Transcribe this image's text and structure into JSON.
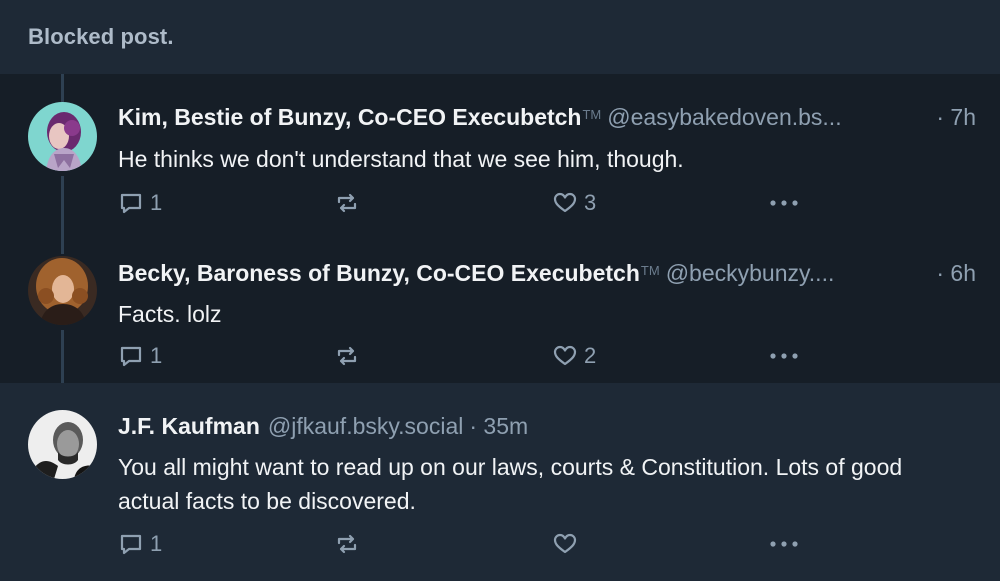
{
  "blocked": {
    "label": "Blocked post."
  },
  "posts": [
    {
      "name": "Kim, Bestie of Bunzy, Co-CEO Execubetch",
      "tm": "TM",
      "handle": "@easybakedoven.bs...",
      "time": "· 7h",
      "text": "He thinks we don't understand that we see him, though.",
      "replies": "1",
      "likes": "3"
    },
    {
      "name": "Becky, Baroness of Bunzy, Co-CEO Execubetch",
      "tm": "TM",
      "handle": "@beckybunzy....",
      "time": "· 6h",
      "text": "Facts. lolz",
      "replies": "1",
      "likes": "2"
    },
    {
      "name": "J.F. Kaufman",
      "handle": "@jfkauf.bsky.social",
      "time": "· 35m",
      "text": "You all might want to read up on our laws, courts & Constitution. Lots of good actual facts to be discovered.",
      "replies": "1",
      "likes": ""
    }
  ],
  "icons": {
    "reply": "reply-icon",
    "repost": "repost-icon",
    "like": "heart-icon",
    "more": "more-options-icon"
  },
  "colors": {
    "background": "#161e27",
    "highlight_background": "#1e2936",
    "text": "#f1f3f5",
    "muted": "#8fa0b1",
    "thread_line": "#2e4052"
  }
}
